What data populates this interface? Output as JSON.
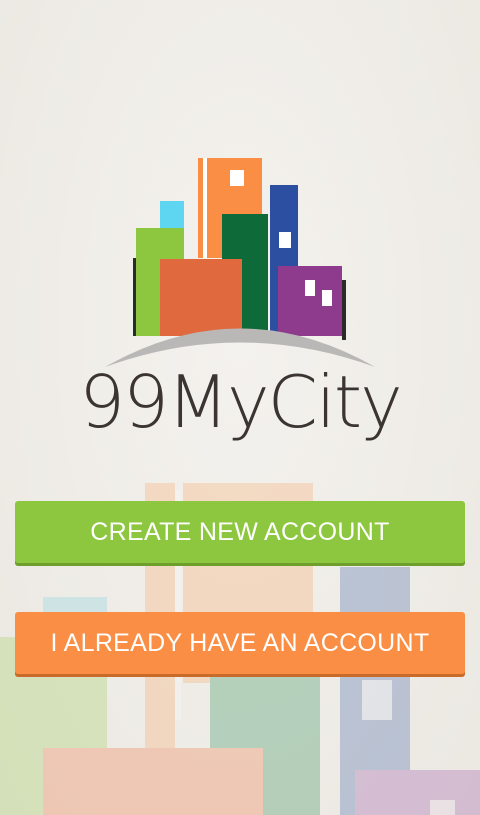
{
  "app": {
    "name": "99MyCity"
  },
  "buttons": {
    "create_account_label": "CREATE NEW ACCOUNT",
    "existing_account_label": "I ALREADY HAVE AN ACCOUNT"
  },
  "colors": {
    "green": "#8dc63f",
    "orange": "#f98e44",
    "text_dark": "#3b3432"
  }
}
